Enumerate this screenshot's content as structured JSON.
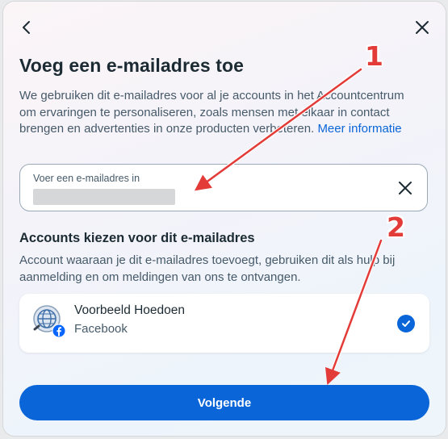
{
  "dialog": {
    "title": "Voeg een e-mailadres toe",
    "description": "We gebruiken dit e-mailadres voor al je accounts in het Accountcentrum om ervaringen te personaliseren, zoals mensen met elkaar in contact brengen en advertenties in onze producten verbeteren.",
    "more_info_link": "Meer informatie",
    "email_field": {
      "label": "Voer een e-mailadres in",
      "value": ""
    },
    "accounts_heading": "Accounts kiezen voor dit e-mailadres",
    "accounts_description": "Account waaraan je dit e-mailadres toevoegt, gebruiken dit als hulp bij aanmelding en om meldingen van ons te ontvangen.",
    "account": {
      "name": "Voorbeeld Hoedoen",
      "platform": "Facebook",
      "selected": true
    },
    "next_button": "Volgende"
  },
  "annotations": {
    "marker_1": "1",
    "marker_2": "2",
    "color": "#e23b38"
  },
  "colors": {
    "accent": "#0a66d8",
    "title_text": "#1c2b33",
    "body_text": "#465a69"
  },
  "icons": {
    "back": "arrow-left-icon",
    "close": "close-icon",
    "clear": "clear-icon",
    "avatar": "globe-avatar-icon",
    "facebook": "facebook-icon",
    "check": "check-icon"
  }
}
